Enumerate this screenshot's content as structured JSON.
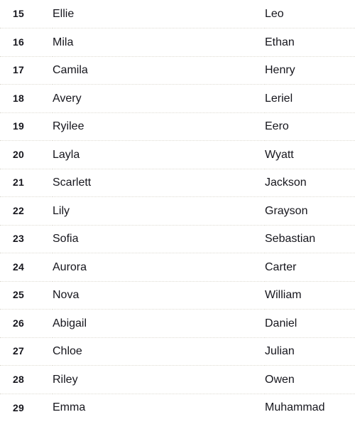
{
  "table": {
    "columns": [
      "rank",
      "female_name",
      "male_name"
    ],
    "rows": [
      {
        "rank": "15",
        "female": "Ellie",
        "male": "Leo"
      },
      {
        "rank": "16",
        "female": "Mila",
        "male": "Ethan"
      },
      {
        "rank": "17",
        "female": "Camila",
        "male": "Henry"
      },
      {
        "rank": "18",
        "female": "Avery",
        "male": "Leriel"
      },
      {
        "rank": "19",
        "female": "Ryilee",
        "male": "Eero"
      },
      {
        "rank": "20",
        "female": "Layla",
        "male": "Wyatt"
      },
      {
        "rank": "21",
        "female": "Scarlett",
        "male": "Jackson"
      },
      {
        "rank": "22",
        "female": "Lily",
        "male": "Grayson"
      },
      {
        "rank": "23",
        "female": "Sofia",
        "male": "Sebastian"
      },
      {
        "rank": "24",
        "female": "Aurora",
        "male": "Carter"
      },
      {
        "rank": "25",
        "female": "Nova",
        "male": "William"
      },
      {
        "rank": "26",
        "female": "Abigail",
        "male": "Daniel"
      },
      {
        "rank": "27",
        "female": "Chloe",
        "male": "Julian"
      },
      {
        "rank": "28",
        "female": "Riley",
        "male": "Owen"
      },
      {
        "rank": "29",
        "female": "Emma",
        "male": "Muhammad"
      }
    ]
  },
  "colors": {
    "background": "#ffffff",
    "text": "#16161d",
    "divider": "#dedbd2"
  }
}
